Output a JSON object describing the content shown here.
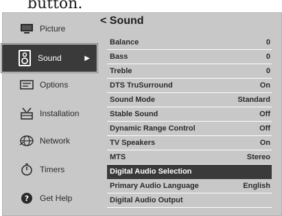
{
  "top_fragment": "button.",
  "sidebar": {
    "items": [
      {
        "label": "Picture",
        "icon": "monitor-icon"
      },
      {
        "label": "Sound",
        "icon": "speaker-icon",
        "active": true
      },
      {
        "label": "Options",
        "icon": "options-icon"
      },
      {
        "label": "Installation",
        "icon": "antenna-icon"
      },
      {
        "label": "Network",
        "icon": "globe-icon"
      },
      {
        "label": "Timers",
        "icon": "timer-icon"
      },
      {
        "label": "Get Help",
        "icon": "help-icon"
      }
    ]
  },
  "panel": {
    "back_symbol": "<",
    "title": "Sound",
    "rows": [
      {
        "label": "Balance",
        "value": "0"
      },
      {
        "label": "Bass",
        "value": "0"
      },
      {
        "label": "Treble",
        "value": "0"
      },
      {
        "label": "DTS TruSurround",
        "value": "On"
      },
      {
        "label": "Sound Mode",
        "value": "Standard"
      },
      {
        "label": "Stable Sound",
        "value": "Off"
      },
      {
        "label": "Dynamic Range Control",
        "value": "Off"
      },
      {
        "label": "TV Speakers",
        "value": "On"
      },
      {
        "label": "MTS",
        "value": "Stereo"
      },
      {
        "label": "Digital Audio Selection",
        "value": "",
        "selected": true
      },
      {
        "label": "Primary Audio Language",
        "value": "English"
      },
      {
        "label": "Digital Audio Output",
        "value": ""
      }
    ]
  },
  "colors": {
    "background": "#c8c8c8",
    "highlight": "#3a3a3a",
    "text": "#2a2a2a"
  }
}
